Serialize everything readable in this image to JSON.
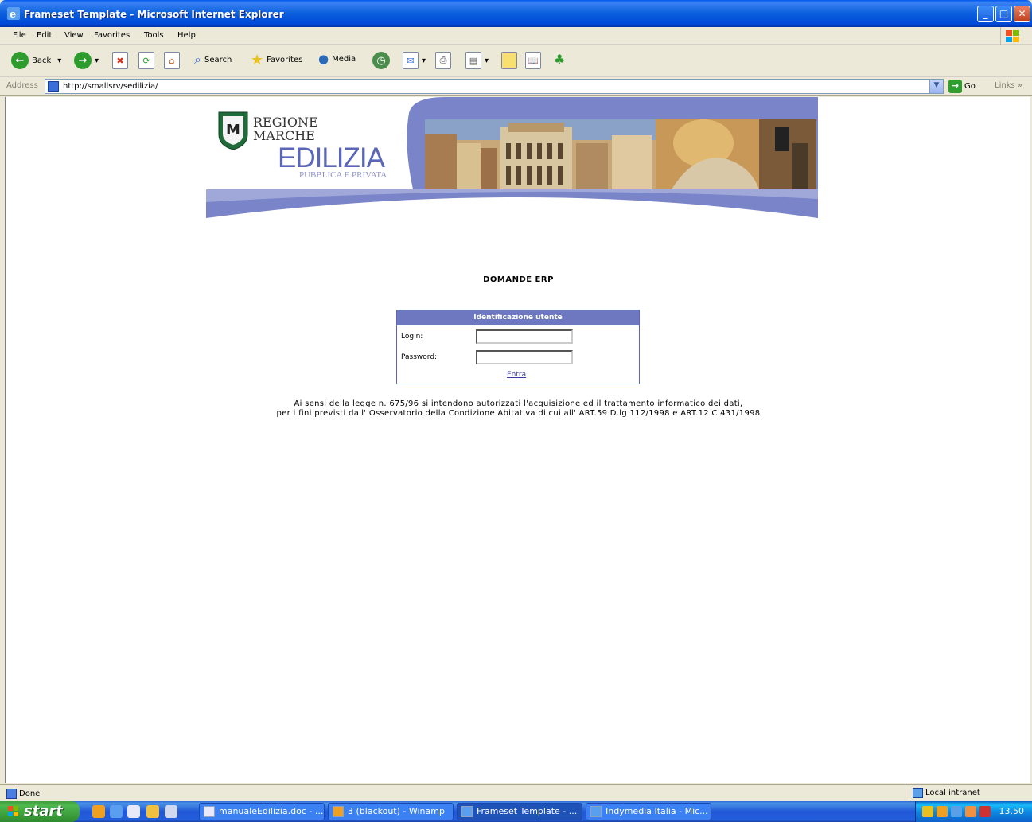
{
  "window": {
    "title": "Frameset Template - Microsoft Internet Explorer",
    "minimize": "_",
    "maximize": "□",
    "close": "✕"
  },
  "menu": [
    "File",
    "Edit",
    "View",
    "Favorites",
    "Tools",
    "Help"
  ],
  "toolbar": {
    "back": "Back",
    "search": "Search",
    "favorites": "Favorites",
    "media": "Media"
  },
  "address": {
    "label": "Address",
    "url": "http://smallsrv/sedilizia/",
    "go": "Go",
    "links": "Links"
  },
  "banner": {
    "regione": "REGIONE",
    "marche": "MARCHE",
    "edilizia": "EDILIZIA",
    "subtitle": "PUBBLICA E PRIVATA"
  },
  "page": {
    "heading": "DOMANDE ERP",
    "login_box_title": "Identificazione utente",
    "login_label": "Login:",
    "password_label": "Password:",
    "submit": "Entra",
    "legal_line1": "Ai sensi della legge n. 675/96 si intendono autorizzati l'acquisizione ed il trattamento informatico dei dati,",
    "legal_line2": "per i fini previsti dall' Osservatorio della Condizione Abitativa di cui all' ART.59 D.lg 112/1998  e ART.12 C.431/1998"
  },
  "status": {
    "text": "Done",
    "zone": "Local intranet"
  },
  "taskbar": {
    "start": "start",
    "tasks": [
      {
        "label": "manualeEdilizia.doc - ...",
        "active": false
      },
      {
        "label": "3  (blackout) - Winamp",
        "active": false
      },
      {
        "label": "Frameset Template - ...",
        "active": true
      },
      {
        "label": "Indymedia Italia - Mic...",
        "active": false
      }
    ],
    "clock": "13.50"
  }
}
